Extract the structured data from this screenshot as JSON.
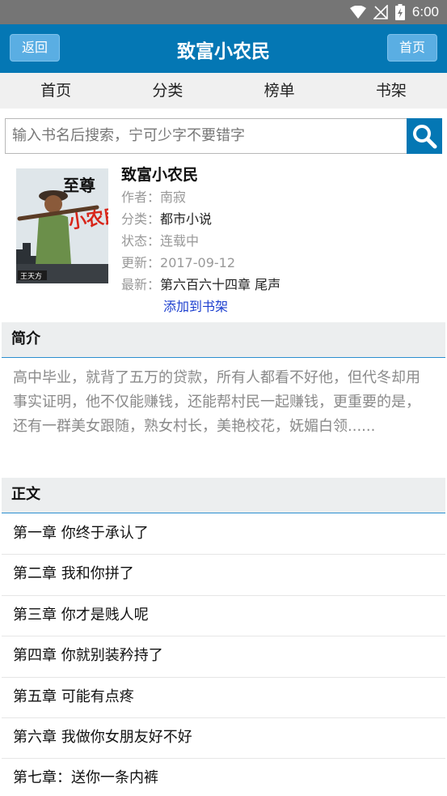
{
  "status_bar": {
    "time": "6:00"
  },
  "header": {
    "back_label": "返回",
    "title": "致富小农民",
    "home_label": "首页"
  },
  "tabs": [
    {
      "label": "首页"
    },
    {
      "label": "分类"
    },
    {
      "label": "榜单"
    },
    {
      "label": "书架"
    }
  ],
  "search": {
    "placeholder": "输入书名后搜索，宁可少字不要错字"
  },
  "book": {
    "title": "致富小农民",
    "author_label": "作者：",
    "author": "南寂",
    "category_label": "分类：",
    "category": "都市小说",
    "status_label": "状态：",
    "status": "连载中",
    "updated_label": "更新：",
    "updated": "2017-09-12",
    "latest_label": "最新：",
    "latest": "第六百六十四章 尾声",
    "add_to_shelf": "添加到书架",
    "cover": {
      "line1": "至尊",
      "line2": "小农民",
      "author_tag": "王天方"
    }
  },
  "intro": {
    "heading": "简介",
    "text": "高中毕业，就背了五万的贷款，所有人都看不好他，但代冬却用事实证明，他不仅能赚钱，还能帮村民一起赚钱，更重要的是，还有一群美女跟随，熟女村长，美艳校花，妩媚白领......"
  },
  "contents": {
    "heading": "正文",
    "chapters": [
      "第一章 你终于承认了",
      "第二章 我和你拼了",
      "第三章 你才是贱人呢",
      "第四章 你就别装矜持了",
      "第五章 可能有点疼",
      "第六章 我做你女朋友好不好",
      "第七章：送你一条内裤"
    ]
  },
  "colors": {
    "primary": "#0477b4",
    "link": "#1c3fcf",
    "statusbar": "#757575"
  }
}
